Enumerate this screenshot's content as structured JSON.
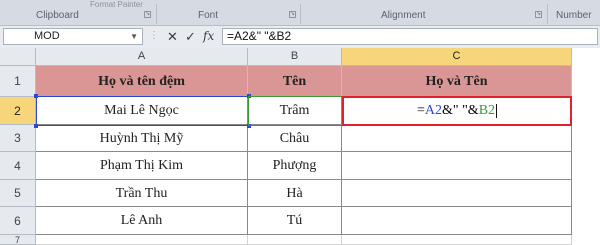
{
  "ribbon": {
    "faded_text": "Format Painter",
    "groups": [
      "Clipboard",
      "Font",
      "Alignment",
      "Number"
    ]
  },
  "formula_bar": {
    "name_box": "MOD",
    "cancel_icon": "✕",
    "enter_icon": "✓",
    "fx_icon": "fx",
    "formula": "=A2&\" \"&B2"
  },
  "grid": {
    "columns": [
      "A",
      "B",
      "C"
    ],
    "rows": [
      "1",
      "2",
      "3",
      "4",
      "5",
      "6",
      "7"
    ],
    "header_row": [
      "Họ và tên đệm",
      "Tên",
      "Họ và Tên"
    ],
    "data": [
      [
        "Mai Lê Ngọc",
        "Trâm"
      ],
      [
        "Huỳnh Thị Mỹ",
        "Châu"
      ],
      [
        "Phạm Thị Kim",
        "Phượng"
      ],
      [
        "Trần Thu",
        "Hà"
      ],
      [
        "Lê Anh",
        "Tú"
      ]
    ],
    "editing": {
      "prefix": "=",
      "ref_a": "A2",
      "middle": "&\" \"&",
      "ref_b": "B2"
    }
  },
  "colors": {
    "header_fill": "#d99694",
    "active_border": "#e0222d",
    "ref_a": "#2a48d8",
    "ref_b": "#3a9a3a"
  }
}
